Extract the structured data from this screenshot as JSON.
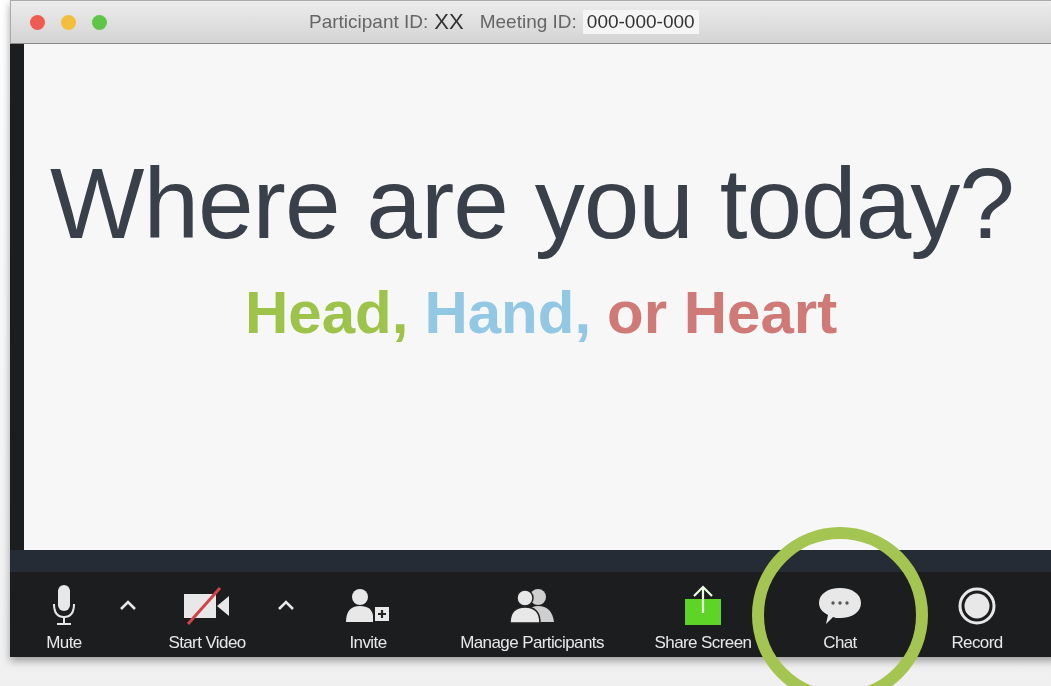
{
  "window": {
    "participant_label": "Participant ID:",
    "participant_id": "XX",
    "meeting_label": "Meeting ID:",
    "meeting_id": "000-000-000"
  },
  "slide": {
    "heading": "Where are you today?",
    "subtitle": [
      {
        "text": "Head,",
        "color": "#9dc34a"
      },
      {
        "text": "Hand,",
        "color": "#93c8e4"
      },
      {
        "text": "or Heart",
        "color": "#cf7a76"
      }
    ]
  },
  "toolbar": [
    {
      "kind": "mic",
      "label": "Mute",
      "has_menu": true,
      "highlighted": false
    },
    {
      "kind": "video",
      "label": "Start Video",
      "has_menu": true,
      "highlighted": false
    },
    {
      "kind": "invite",
      "label": "Invite",
      "has_menu": false,
      "highlighted": false
    },
    {
      "kind": "participants",
      "label": "Manage Participants",
      "has_menu": false,
      "highlighted": false
    },
    {
      "kind": "share",
      "label": "Share Screen",
      "has_menu": false,
      "highlighted": false
    },
    {
      "kind": "chat",
      "label": "Chat",
      "has_menu": false,
      "highlighted": true
    },
    {
      "kind": "record",
      "label": "Record",
      "has_menu": false,
      "highlighted": false
    }
  ]
}
